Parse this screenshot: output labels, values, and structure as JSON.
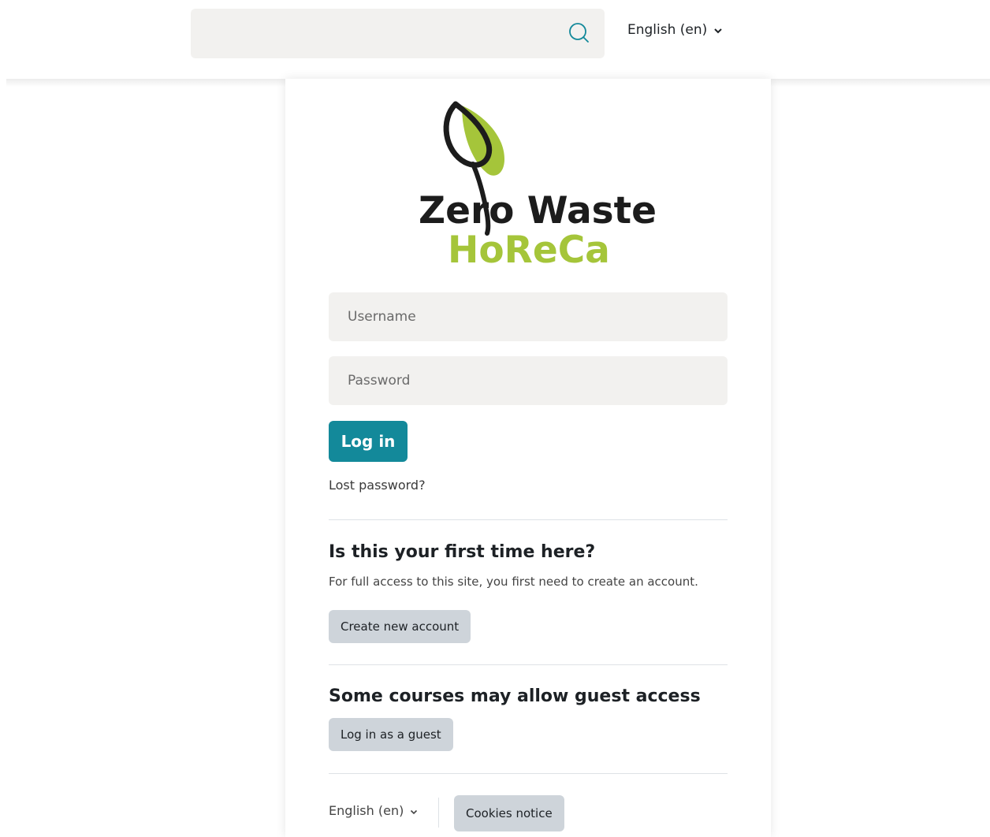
{
  "header": {
    "search_placeholder": "",
    "language_label": "English (en)"
  },
  "logo": {
    "line1": "Zero Waste",
    "line2": "HoReCa",
    "colors": {
      "dark": "#1c1c1c",
      "green": "#a5c53a"
    }
  },
  "login": {
    "username_placeholder": "Username",
    "password_placeholder": "Password",
    "login_button": "Log in",
    "lost_password": "Lost password?"
  },
  "signup": {
    "heading": "Is this your first time here?",
    "description": "For full access to this site, you first need to create an account.",
    "create_button": "Create new account"
  },
  "guest": {
    "heading": "Some courses may allow guest access",
    "guest_button": "Log in as a guest"
  },
  "footer": {
    "language_label": "English (en)",
    "cookies_button": "Cookies notice"
  },
  "colors": {
    "primary": "#13899a",
    "secondary_button": "#ced4da",
    "input_bg": "#f2f1ef"
  }
}
